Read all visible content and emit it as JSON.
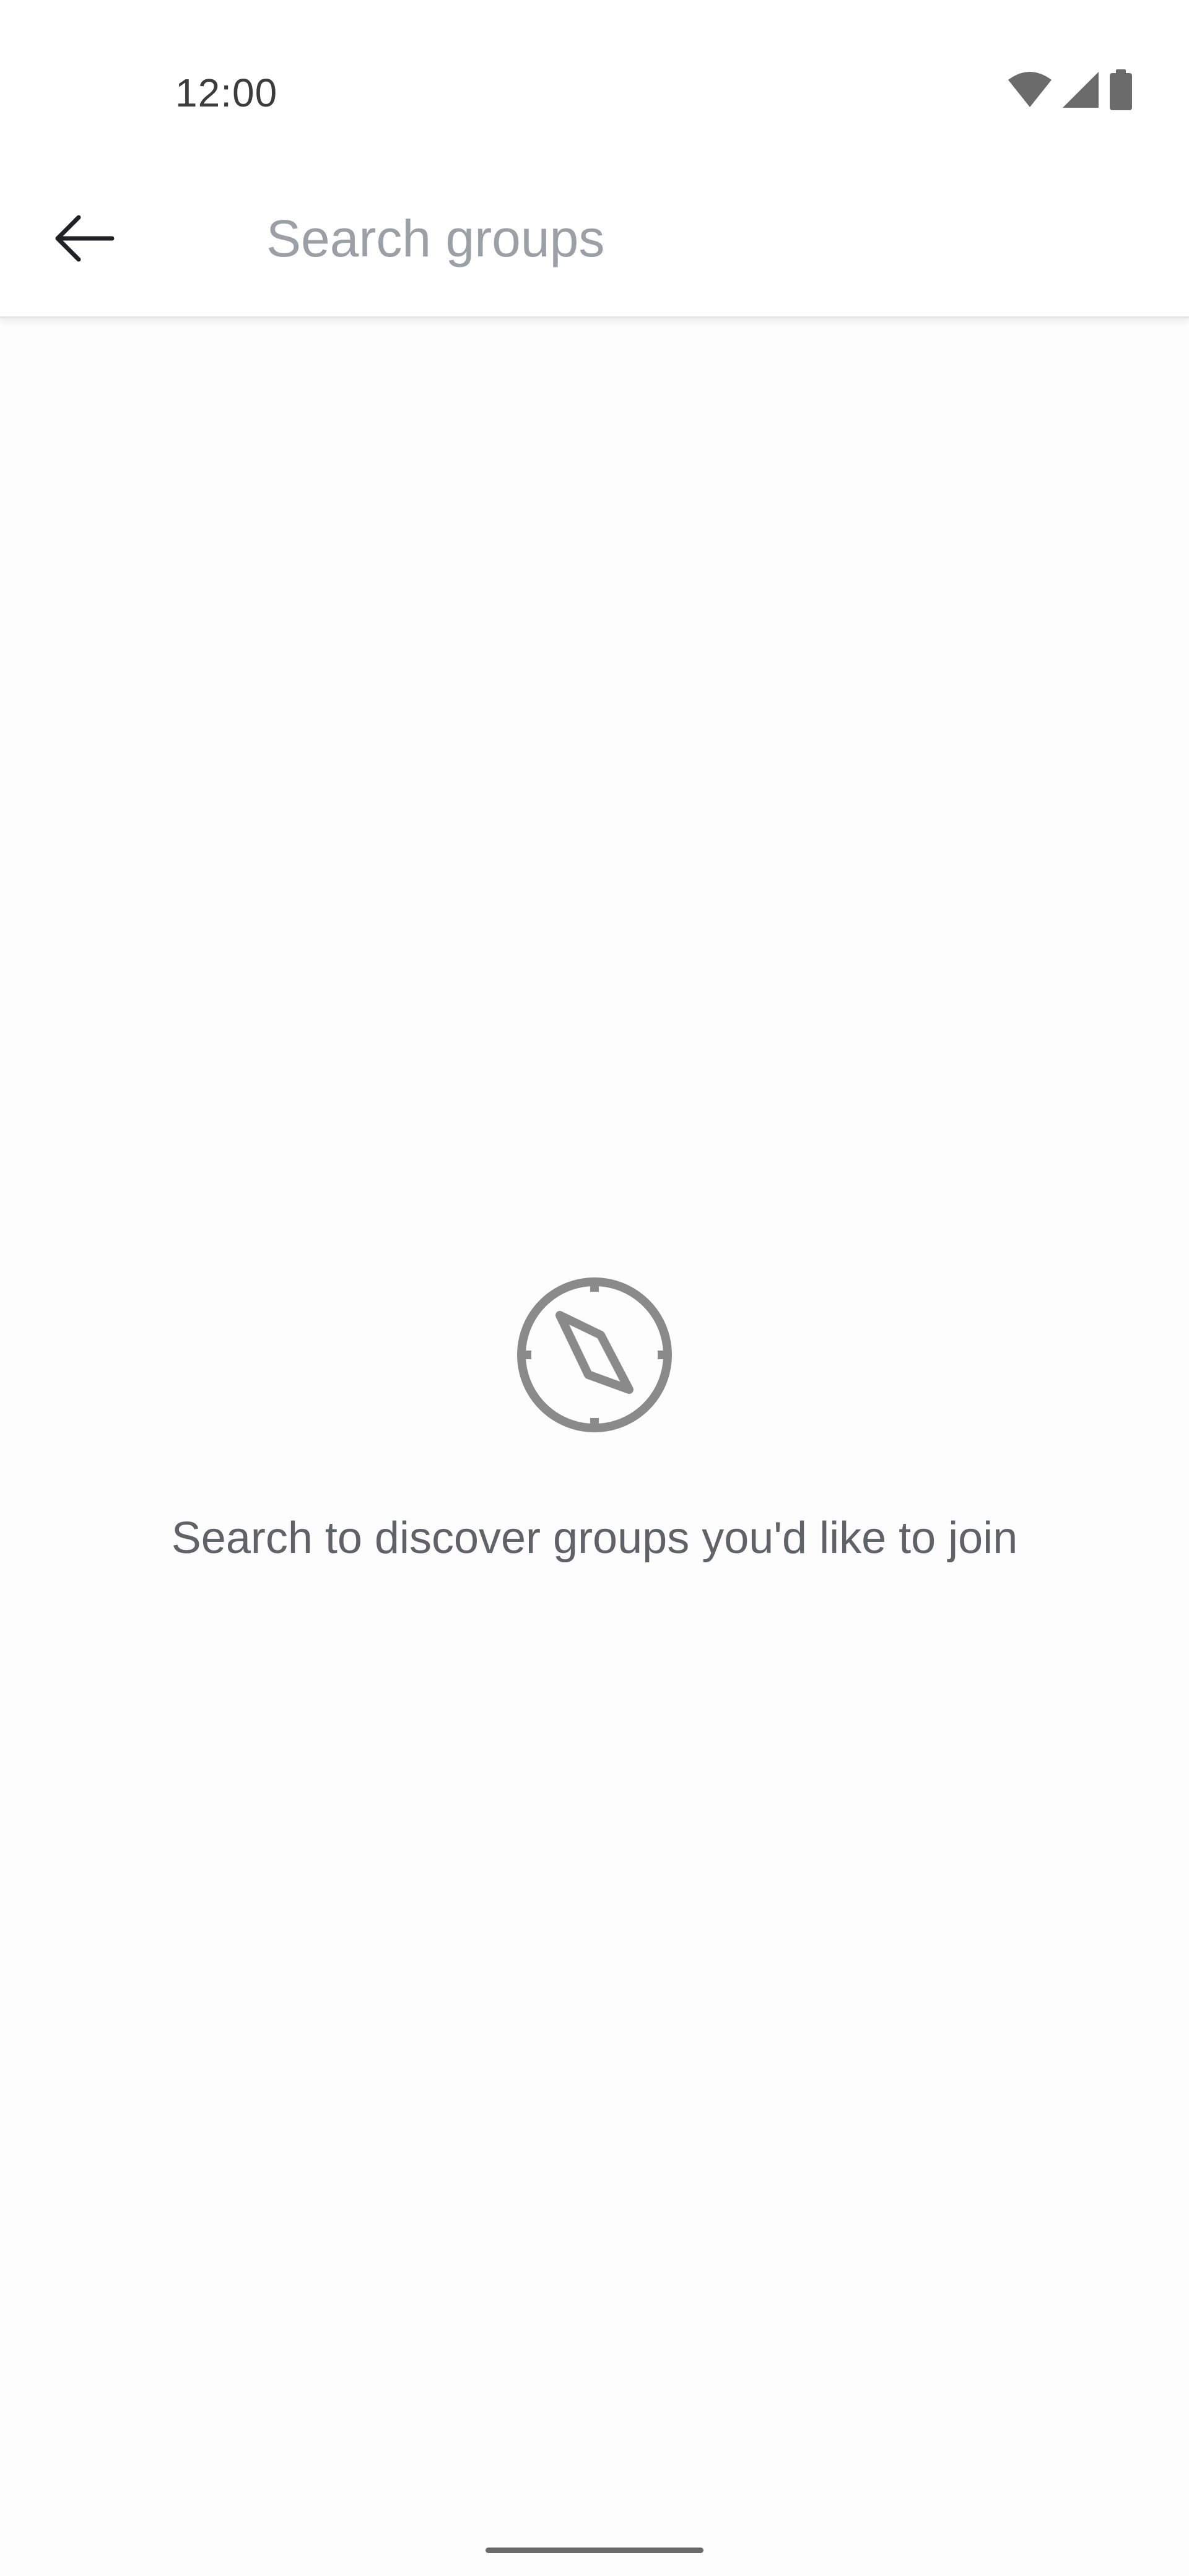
{
  "status_bar": {
    "time": "12:00",
    "icons": [
      "wifi-icon",
      "cellular-signal-icon",
      "battery-icon"
    ]
  },
  "app_bar": {
    "back_icon": "arrow-back-icon",
    "search": {
      "value": "",
      "placeholder": "Search groups"
    }
  },
  "empty_state": {
    "icon": "compass-icon",
    "message": "Search to discover groups you'd like to join"
  },
  "colors": {
    "background": "#fdfdfd",
    "icon_gray": "#8a8a8a",
    "message_text": "#5f6368",
    "placeholder_text": "#9aa0a6"
  }
}
